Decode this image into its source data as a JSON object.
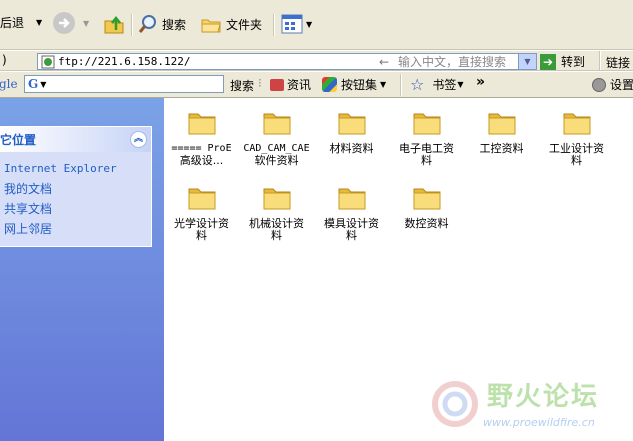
{
  "toolbar": {
    "back_label": "后退",
    "search_label": "搜索",
    "folders_label": "文件夹"
  },
  "address": {
    "prefix": ")",
    "url": "ftp://221.6.158.122/",
    "placeholder": "输入中文，直接搜索",
    "go_label": "转到",
    "links_label": "链接"
  },
  "google": {
    "brand": "gle",
    "search_label": "搜索",
    "news_label": "资讯",
    "popups_label": "按钮集",
    "bookmarks_label": "书签",
    "more": "»",
    "settings_label": "设置"
  },
  "sidebar": {
    "title": "它位置",
    "places": [
      "Internet Explorer",
      "我的文档",
      "共享文档",
      "网上邻居"
    ]
  },
  "folders": [
    {
      "line1": "===== ProE",
      "line2": "高级设..."
    },
    {
      "line1": "CAD_CAM_CAE",
      "line2": "软件资料"
    },
    {
      "line1": "材料资料",
      "line2": ""
    },
    {
      "line1": "电子电工资",
      "line2": "料"
    },
    {
      "line1": "工控资料",
      "line2": ""
    },
    {
      "line1": "工业设计资",
      "line2": "料"
    },
    {
      "line1": "光学设计资",
      "line2": "料"
    },
    {
      "line1": "机械设计资",
      "line2": "料"
    },
    {
      "line1": "模具设计资",
      "line2": "料"
    },
    {
      "line1": "数控资料",
      "line2": ""
    }
  ],
  "watermark": {
    "brand": "野火论坛",
    "url": "www.proewildfire.cn"
  },
  "colors": {
    "sidebar_top": "#7ba2e7",
    "sidebar_bottom": "#6375d6",
    "folder_yellow": "#f7d56b",
    "link_blue": "#215dc6",
    "watermark_green": "#7cc45a"
  }
}
